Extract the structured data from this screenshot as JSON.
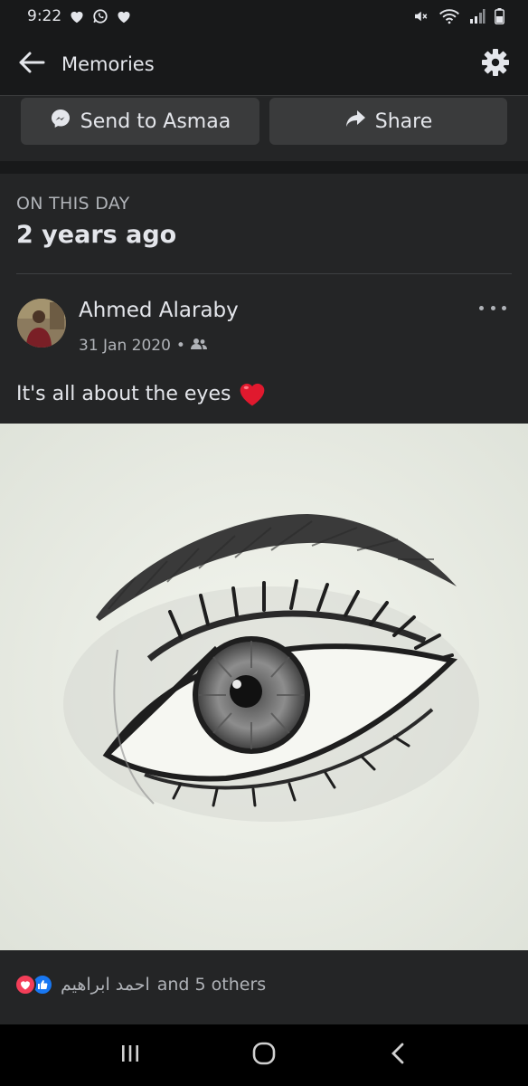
{
  "status_bar": {
    "time": "9:22",
    "left_icons": [
      "heart-icon",
      "whatsapp-icon",
      "heart-icon"
    ],
    "right_icons": [
      "mute-icon",
      "wifi-icon",
      "signal-icon",
      "battery-icon"
    ]
  },
  "app_bar": {
    "title": "Memories"
  },
  "actions": {
    "send_label": "Send to Asmaa",
    "share_label": "Share"
  },
  "card": {
    "day_label": "ON THIS DAY",
    "years_ago": "2 years ago"
  },
  "post": {
    "author": "Ahmed Alaraby",
    "date": "31 Jan 2020",
    "separator": "•",
    "audience_icon": "friends-icon",
    "text": "It's all about the eyes",
    "emoji": "red-heart",
    "photo": "pencil sketch of an eye"
  },
  "reactions": {
    "icons": [
      "love",
      "like"
    ],
    "name": "احمد ابراهيم",
    "others": "and 5 others"
  },
  "colors": {
    "background": "#18191a",
    "card": "#242526",
    "button": "#3a3b3c",
    "text": "#e4e6eb",
    "secondary_text": "#b0b3b8",
    "like": "#1877f2",
    "love": "#f33e58"
  }
}
